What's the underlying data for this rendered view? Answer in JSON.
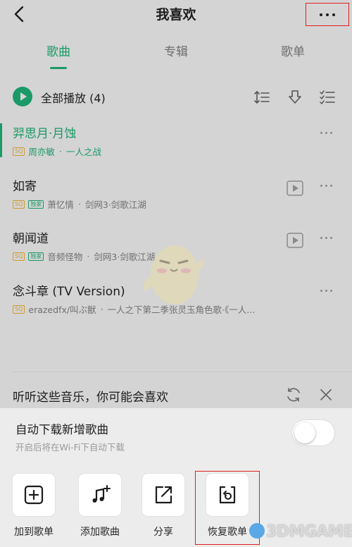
{
  "header": {
    "title": "我喜欢",
    "back_icon": "chevron-left-icon",
    "more_icon": "more-horizontal-icon",
    "highlight_color": "#e0201c"
  },
  "tabs": [
    {
      "label": "歌曲",
      "active": true
    },
    {
      "label": "专辑",
      "active": false
    },
    {
      "label": "歌单",
      "active": false
    }
  ],
  "playall": {
    "label": "全部播放",
    "count": "(4)",
    "icons": [
      "sort-icon",
      "download-icon",
      "multi-select-icon"
    ]
  },
  "songs": [
    {
      "title": "羿思月·月蚀",
      "quality": "SQ",
      "exclusive": "",
      "artist": "周亦敏",
      "sep": "·",
      "album": "一人之战",
      "playing": true
    },
    {
      "title": "如寄",
      "quality": "SQ",
      "exclusive": "独家",
      "artist": "萧忆情",
      "sep": "·",
      "album": "剑网3·剑歌江湖",
      "playing": false
    },
    {
      "title": "朝闻道",
      "quality": "SQ",
      "exclusive": "独家",
      "artist": "音频怪物",
      "sep": "·",
      "album": "剑网3·剑歌江湖",
      "playing": false
    },
    {
      "title": "念斗章 (TV Version)",
      "quality": "SQ",
      "exclusive": "",
      "artist": "erazedfx/叫ぶ獣",
      "sep": "·",
      "album": "一人之下第二季张灵玉角色歌·《一人...",
      "playing": false
    }
  ],
  "recommend": {
    "label": "听听这些音乐，你可能会喜欢"
  },
  "sheet": {
    "auto_download_title": "自动下载新增歌曲",
    "auto_download_sub": "开启后将在Wi-Fi下自动下载",
    "auto_download_on": false,
    "actions": [
      {
        "label": "加到歌单",
        "icon": "add-square-icon"
      },
      {
        "label": "添加歌曲",
        "icon": "add-music-icon"
      },
      {
        "label": "分享",
        "icon": "share-icon"
      },
      {
        "label": "恢复歌单",
        "icon": "restore-icon"
      }
    ]
  },
  "watermark": "3DMGAME",
  "colors": {
    "accent": "#1a9a67",
    "overlay_bg": "#d4d4d4",
    "sheet_bg": "#ececec",
    "sq_badge": "#d19a2c"
  }
}
